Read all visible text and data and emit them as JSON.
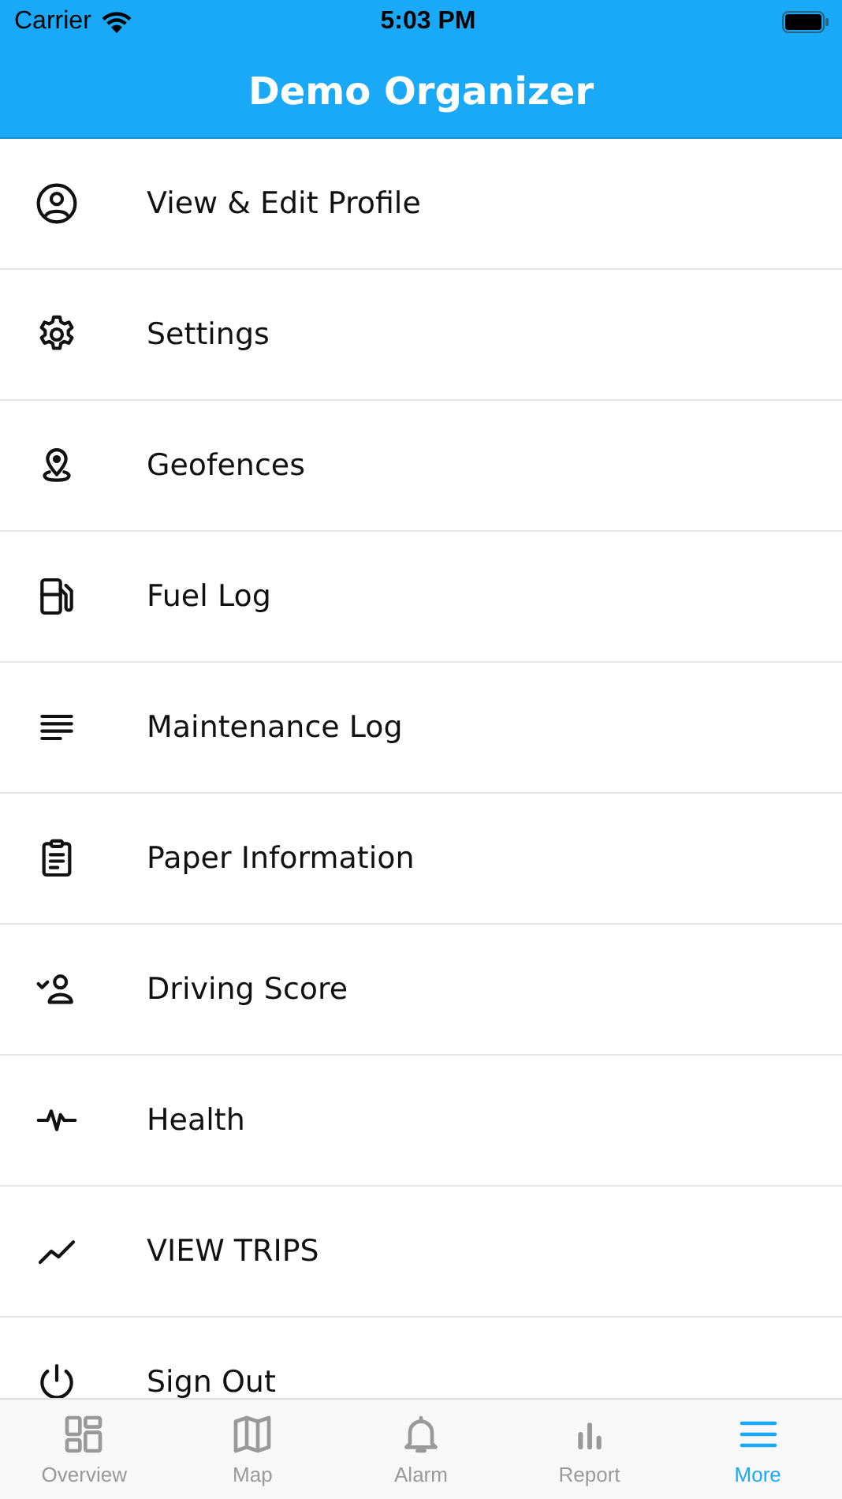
{
  "status_bar": {
    "carrier": "Carrier",
    "time": "5:03 PM"
  },
  "nav": {
    "title": "Demo Organizer"
  },
  "menu": [
    {
      "label": "View & Edit Profile"
    },
    {
      "label": "Settings"
    },
    {
      "label": "Geofences"
    },
    {
      "label": "Fuel Log"
    },
    {
      "label": "Maintenance Log"
    },
    {
      "label": "Paper Information"
    },
    {
      "label": "Driving Score"
    },
    {
      "label": "Health"
    },
    {
      "label": "VIEW TRIPS"
    },
    {
      "label": "Sign Out"
    }
  ],
  "tabs": [
    {
      "label": "Overview",
      "selected": false
    },
    {
      "label": "Map",
      "selected": false
    },
    {
      "label": "Alarm",
      "selected": false
    },
    {
      "label": "Report",
      "selected": false
    },
    {
      "label": "More",
      "selected": true
    }
  ]
}
